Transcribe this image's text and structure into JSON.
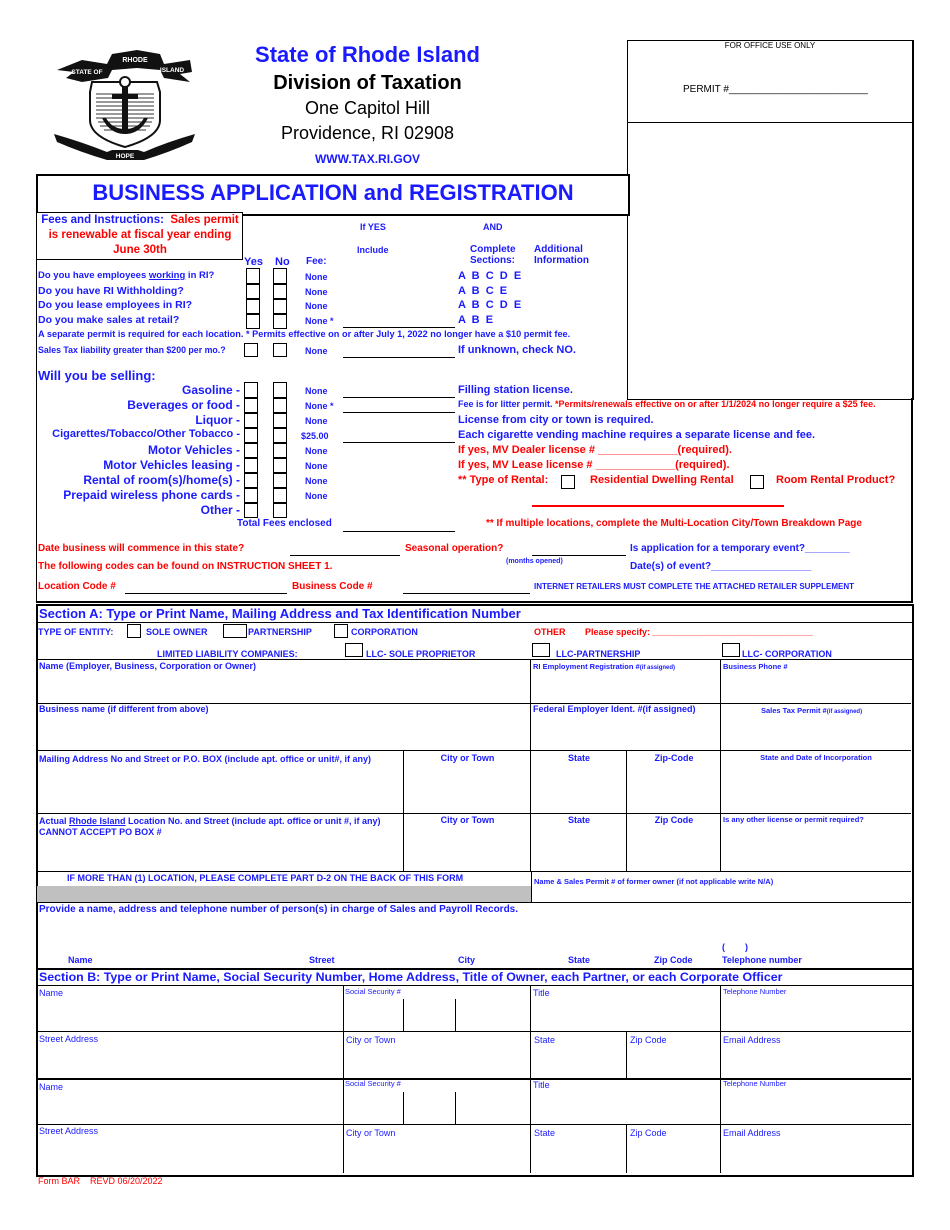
{
  "header": {
    "state": "State of Rhode Island",
    "division": "Division of Taxation",
    "address1": "One Capitol Hill",
    "address2": "Providence, RI 02908",
    "website": "WWW.TAX.RI.GOV",
    "seal": {
      "top": "RHODE",
      "left": "STATE OF",
      "right": "ISLAND",
      "bottom": "HOPE"
    }
  },
  "office": {
    "title": "FOR OFFICE USE ONLY",
    "permit_label": "PERMIT #_________________________"
  },
  "form_title": "BUSINESS APPLICATION and REGISTRATION",
  "fees": {
    "heading_blue": "Fees and Instructions:",
    "heading_red": "Sales permit is renewable at fiscal year ending June 30th",
    "col_if_yes": "If YES",
    "col_and": "AND",
    "col_include": "Include",
    "col_complete": "Complete",
    "col_sections": "Sections:",
    "col_additional": "Additional",
    "col_information": "Information",
    "col_yes": "Yes",
    "col_no": "No",
    "col_fee": "Fee:",
    "questions": [
      {
        "pre": "Do you have employees ",
        "u": "working",
        "post": " in RI?",
        "fee": "None",
        "sections": "A  B  C  D  E"
      },
      {
        "pre": "Do you have RI Withholding?",
        "u": "",
        "post": "",
        "fee": "None",
        "sections": "A  B  C  E"
      },
      {
        "pre": "Do you lease employees in RI?",
        "u": "",
        "post": "",
        "fee": "None",
        "sections": "A  B  C  D  E"
      },
      {
        "pre": "Do you make sales at retail?",
        "u": "",
        "post": "",
        "fee": "None *",
        "sections": "A  B  E"
      }
    ],
    "separate_permit_note": "A separate permit is required for each location.  * Permits effective on or after July 1, 2022 no longer have a $10 permit fee.",
    "sales_tax_question": "Sales Tax liability greater than $200 per mo.?",
    "sales_tax_fee": "None",
    "sales_tax_note": "If unknown, check NO."
  },
  "selling": {
    "heading": "Will you be selling:",
    "items": [
      {
        "label": "Gasoline -",
        "fee": "None",
        "info": "Filling station license.",
        "info_color": "blue"
      },
      {
        "label": "Beverages or food -",
        "fee": "None *",
        "info": "Fee is for litter permit.",
        "info2": " *Permits/renewals effective on or after 1/1/2024 no longer require a $25 fee.",
        "info_color": "blue"
      },
      {
        "label": "Liquor -",
        "fee": "None",
        "info": "License from city or town is required.",
        "info_color": "blue"
      },
      {
        "label": "Cigarettes/Tobacco/Other Tobacco -",
        "fee": "$25.00",
        "info": "Each cigarette vending machine requires a separate license and fee.",
        "info_color": "blue"
      },
      {
        "label": "Motor Vehicles -",
        "fee": "None",
        "info": "If yes, MV Dealer license # _____________(required).",
        "info_color": "red"
      },
      {
        "label": "Motor Vehicles leasing -",
        "fee": "None",
        "info": "If yes, MV Lease license # _____________(required).",
        "info_color": "red"
      },
      {
        "label": "Rental of room(s)/home(s) -",
        "fee": "None",
        "info": "** Type of Rental:",
        "info_color": "red"
      },
      {
        "label": "Prepaid wireless phone cards -",
        "fee": "None",
        "info": "",
        "info_color": "blue"
      },
      {
        "label": "Other -",
        "fee": "",
        "info": "",
        "info_color": "blue"
      }
    ],
    "rental_option1": "Residential Dwelling Rental",
    "rental_option2": "Room Rental Product?",
    "total_fees": "Total Fees enclosed",
    "multi_location_note": "** If multiple locations, complete the Multi-Location City/Town Breakdown Page"
  },
  "dates": {
    "commence": "Date business will commence in this state?",
    "seasonal": "Seasonal operation?",
    "months_opened": "(months opened)",
    "temporary_event": "Is application for a temporary event?________",
    "codes_note": "The following codes can be found on INSTRUCTION SHEET 1.",
    "dates_of_event": "Date(s) of event?__________________",
    "location_code": "Location Code #",
    "business_code": "Business Code #",
    "internet_note": "INTERNET RETAILERS MUST COMPLETE THE ATTACHED RETAILER SUPPLEMENT"
  },
  "section_a": {
    "title": "Section A:  Type or Print Name, Mailing Address and Tax Identification Number",
    "entity_label": "TYPE OF ENTITY:",
    "sole_owner": "SOLE OWNER",
    "partnership": "PARTNERSHIP",
    "corporation": "CORPORATION",
    "other": "OTHER",
    "please_specify": "Please specify: ________________________________",
    "llc_label": "LIMITED LIABILITY COMPANIES:",
    "llc_sole": "LLC- SOLE PROPRIETOR",
    "llc_partnership": "LLC-PARTNERSHIP",
    "llc_corporation": "LLC- CORPORATION",
    "name_label": "Name (Employer, Business, Corporation or Owner)",
    "ri_emp_reg": "RI Employment Registration #",
    "if_assigned": "(if assigned)",
    "business_phone": "Business Phone #",
    "business_name": "Business name (if different from above)",
    "fein": "Federal Employer Ident. #(if assigned)",
    "sales_tax_permit": "Sales Tax Permit #",
    "mailing_address": "Mailing Address No and Street or P.O. BOX (include apt. office or unit#, if any)",
    "city_or_town": "City or Town",
    "state": "State",
    "zip_code_dash": "Zip-Code",
    "state_date_inc": "State and Date of Incorporation",
    "actual_pre": "Actual ",
    "actual_u": "Rhode Island",
    "actual_post": " Location No. and Street (include apt. office or unit #, if any)  CANNOT ACCEPT PO BOX #",
    "zip_code": "Zip Code",
    "other_license": "Is any other license or permit required?",
    "more_than_one": "IF MORE THAN (1) LOCATION, PLEASE COMPLETE PART D-2 ON THE BACK OF THIS FORM",
    "former_owner": "Name & Sales Permit # of former owner (if not applicable write N/A)",
    "records_person": "Provide a name, address and telephone number of person(s) in charge of Sales and Payroll Records.",
    "paren": "(        )",
    "cols": [
      "Name",
      "Street",
      "City",
      "State",
      "Zip Code",
      "Telephone number"
    ]
  },
  "section_b": {
    "title": "Section B: Type or Print Name, Social Security Number, Home Address, Title of Owner, each Partner, or each Corporate Officer",
    "name": "Name",
    "ssn": "Social Security #",
    "title_lbl": "Title",
    "telephone": "Telephone Number",
    "street_address": "Street Address",
    "city_or_town": "City or Town",
    "state": "State",
    "zip_code": "Zip Code",
    "email": "Email Address"
  },
  "footer": {
    "form_id": "Form BAR    REVD 06/20/2022"
  }
}
